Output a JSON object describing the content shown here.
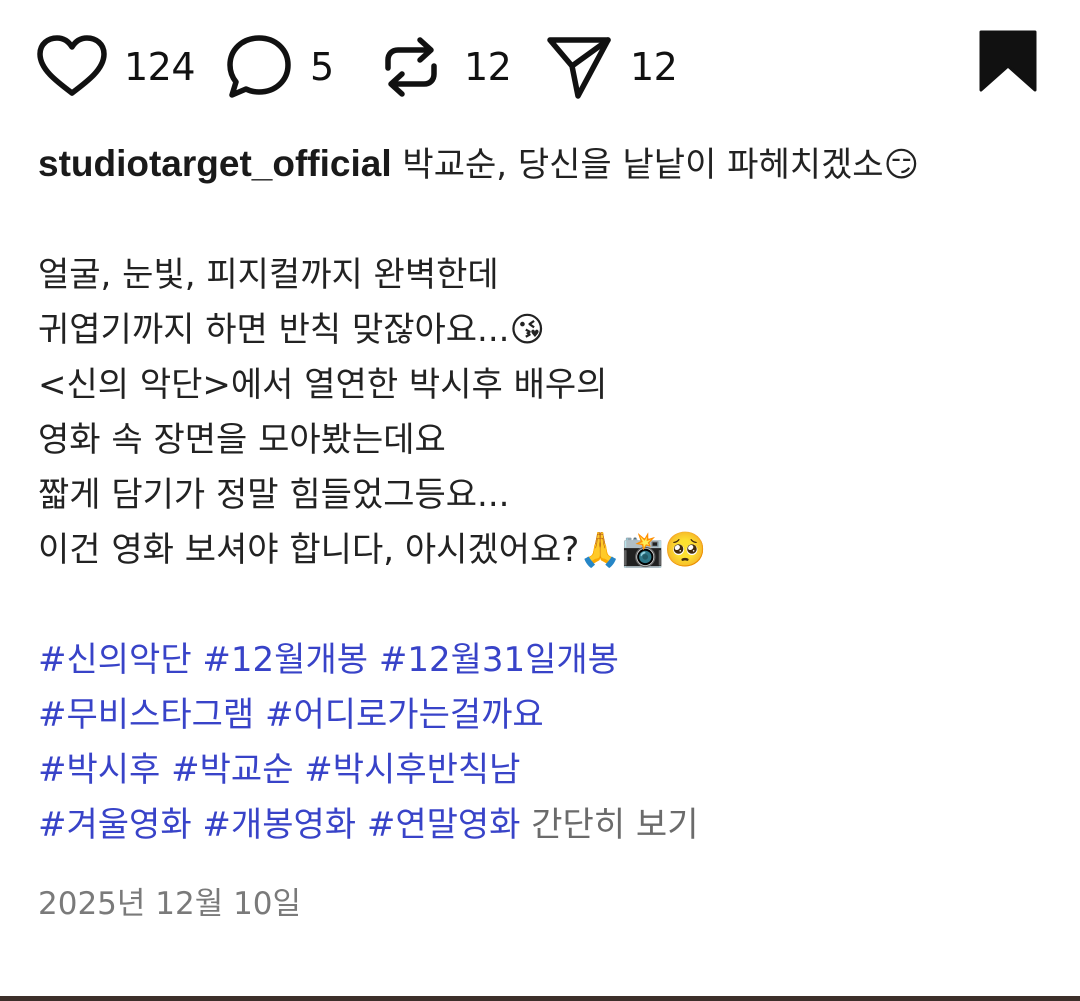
{
  "actions": {
    "likes": "124",
    "comments": "5",
    "reposts": "12",
    "shares": "12"
  },
  "post": {
    "username": "studiotarget_official",
    "title": "박교순, 당신을 낱낱이 파헤치겠소😏",
    "body": [
      "얼굴, 눈빛, 피지컬까지 완벽한데",
      "귀엽기까지 하면 반칙 맞잖아요...😘",
      "<신의 악단>에서 열연한 박시후 배우의",
      "영화 속 장면을 모아봤는데요",
      "짧게 담기가 정말 힘들었그등요...",
      "이건 영화 보셔야 합니다, 아시겠어요?🙏📸🥺"
    ],
    "hashtags": [
      [
        "#신의악단",
        "#12월개봉",
        "#12월31일개봉"
      ],
      [
        "#무비스타그램",
        "#어디로가는걸까요"
      ],
      [
        "#박시후",
        "#박교순",
        "#박시후반칙남"
      ],
      [
        "#겨울영화",
        "#개봉영화",
        "#연말영화"
      ]
    ],
    "more_label": "간단히 보기",
    "date": "2025년 12월 10일"
  },
  "colors": {
    "hashtag": "#3843c8",
    "text": "#222222",
    "muted": "#7a7a7a"
  },
  "icons": {
    "like": "heart-icon",
    "comment": "speech-bubble-icon",
    "repost": "repost-arrows-icon",
    "share": "paper-plane-icon",
    "bookmark": "bookmark-icon"
  }
}
